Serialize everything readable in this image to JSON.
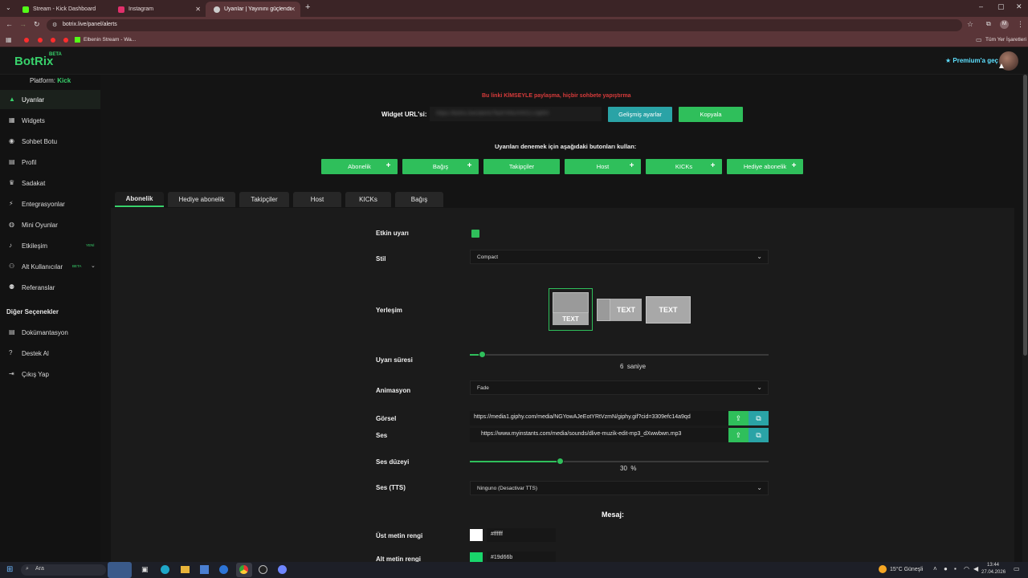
{
  "browser": {
    "tabs": [
      {
        "label": "Stream - Kick Dashboard",
        "color": "#53fc18"
      },
      {
        "label": "Instagram",
        "color": "#e1306c"
      },
      {
        "label": "Uyarılar | Yayınını güçlendirmek",
        "color": "#cccccc"
      }
    ],
    "url": "botrix.live/panel/alerts",
    "bookmark": "Elbenin Stream - Wa...",
    "all_bookmarks": "Tüm Yer İşaretleri",
    "profile_letter": "M"
  },
  "app": {
    "logo": "BotRix",
    "logo_badge": "BETA",
    "premium": "Premium'a geç",
    "platform_label": "Platform:",
    "platform_value": "Kick"
  },
  "sidebar": {
    "items": [
      {
        "label": "Uyarılar",
        "icon": "warning-icon"
      },
      {
        "label": "Widgets",
        "icon": "grid-icon"
      },
      {
        "label": "Sohbet Botu",
        "icon": "robot-icon"
      },
      {
        "label": "Profil",
        "icon": "id-card-icon"
      },
      {
        "label": "Sadakat",
        "icon": "trophy-icon"
      },
      {
        "label": "Entegrasyonlar",
        "icon": "plug-icon"
      },
      {
        "label": "Mini Oyunlar",
        "icon": "gamepad-icon"
      },
      {
        "label": "Etkileşim",
        "icon": "music-icon",
        "badge": "YENİ"
      },
      {
        "label": "Alt Kullanıcılar",
        "icon": "users-icon",
        "badge": "BETA"
      },
      {
        "label": "Referanslar",
        "icon": "people-icon"
      }
    ],
    "other_title": "Diğer Seçenekler",
    "other_items": [
      {
        "label": "Dokümantasyon",
        "icon": "docs-icon"
      },
      {
        "label": "Destek Al",
        "icon": "help-icon"
      },
      {
        "label": "Çıkış Yap",
        "icon": "logout-icon"
      }
    ]
  },
  "widget": {
    "warning": "Bu linki KİMSEYLE paylaşma, hiçbir sohbete yapıştırma",
    "url_label": "Widget URL'si:",
    "url_value": "https://botrix.live/alerts?bid=hNcrHXCLUq6IH",
    "advanced_button": "Gelişmiş ayarlar",
    "copy_button": "Kopyala",
    "test_hint": "Uyarıları denemek için aşağıdaki butonları kullan:",
    "test_buttons": [
      "Abonelik",
      "Bağış",
      "Takipçiler",
      "Host",
      "KICKs",
      "Hediye abonelik"
    ]
  },
  "tabs": [
    "Abonelik",
    "Hediye abonelik",
    "Takipçiler",
    "Host",
    "KICKs",
    "Bağış"
  ],
  "form": {
    "enabled_label": "Etkin uyarı",
    "style_label": "Stil",
    "style_value": "Compact",
    "layout_label": "Yerleşim",
    "layout_text": "TEXT",
    "duration_label": "Uyarı süresi",
    "duration_value": "6",
    "duration_unit": "saniye",
    "animation_label": "Animasyon",
    "animation_value": "Fade",
    "image_label": "Görsel",
    "image_url": "https://media1.giphy.com/media/NGYowAJeEotYRtVzmN/giphy.gif?cid=3309efc14a9qd",
    "sound_label": "Ses",
    "sound_url": "https://www.myinstants.com/media/sounds/dlive-muzik-edit-mp3_dXwwbwn.mp3",
    "volume_label": "Ses düzeyi",
    "volume_value": "30",
    "volume_unit": "%",
    "volume_fraction": 0.3,
    "duration_fraction": 0.04,
    "tts_label": "Ses (TTS)",
    "tts_value": "Ninguno (Desactivar TTS)",
    "message_title": "Mesaj:",
    "top_color_label": "Üst metin rengi",
    "top_color_value": "#ffffff",
    "bottom_color_label": "Alt metin rengi",
    "bottom_color_value": "#19d66b"
  },
  "taskbar": {
    "search": "Ara",
    "weather": "15°C Güneşli",
    "time": "13:44",
    "date": "27.04.2026"
  },
  "colors": {
    "accent": "#2fbf5b",
    "teal": "#2aa3a6",
    "warning": "#d83b3b"
  }
}
